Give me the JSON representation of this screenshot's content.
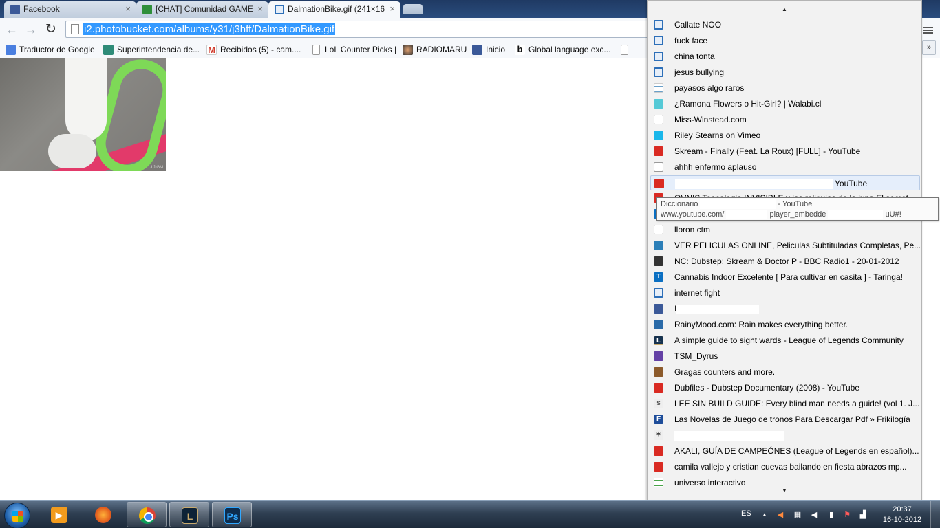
{
  "tabs": [
    {
      "title": "Facebook",
      "close": "×"
    },
    {
      "title": "[CHAT] Comunidad GAME",
      "close": "×"
    },
    {
      "title": "DalmationBike.gif (241×16",
      "close": "×"
    }
  ],
  "toolbar": {
    "back": "←",
    "forward": "→",
    "reload": "↻",
    "url": "i2.photobucket.com/albums/y31/j3hff/DalmationBike.gif"
  },
  "bookmarks": [
    {
      "label": "Traductor de Google",
      "icon": "translate-icon"
    },
    {
      "label": "Superintendencia de...",
      "icon": "si-icon"
    },
    {
      "label": "Recibidos (5) - cam....",
      "icon": "gmail-icon"
    },
    {
      "label": "LoL Counter Picks |",
      "icon": "page-icon"
    },
    {
      "label": "RADIOMARU",
      "icon": "avatar-icon"
    },
    {
      "label": "Inicio",
      "icon": "facebook-icon"
    },
    {
      "label": "Global language exc...",
      "icon": "b-icon"
    }
  ],
  "bookmarks_overflow": "»",
  "image": {
    "watermark": "J.J.GM"
  },
  "dropdown": {
    "scroll_up": "▲",
    "scroll_down": "▼",
    "items": [
      {
        "label": "Callate NOO",
        "icon": "photobucket-icon",
        "cls": "i-photo"
      },
      {
        "label": "fuck face",
        "icon": "photobucket-icon",
        "cls": "i-photo"
      },
      {
        "label": "china tonta",
        "icon": "photobucket-icon",
        "cls": "i-photo"
      },
      {
        "label": "jesus bullying",
        "icon": "photobucket-icon",
        "cls": "i-photo"
      },
      {
        "label": "payasos algo raros",
        "icon": "lines-icon",
        "cls": "i-lines"
      },
      {
        "label": "¿Ramona Flowers o Hit-Girl? | Walabi.cl",
        "icon": "walabi-icon",
        "cls": "i-walabi"
      },
      {
        "label": "Miss-Winstead.com",
        "icon": "page-icon",
        "cls": "i-doc"
      },
      {
        "label": "Riley Stearns on Vimeo",
        "icon": "vimeo-icon",
        "cls": "i-vimeo"
      },
      {
        "label": "Skream - Finally (Feat. La Roux) [FULL] - YouTube",
        "icon": "youtube-icon",
        "cls": "i-yt"
      },
      {
        "label": "ahhh enfermo aplauso",
        "icon": "page-icon",
        "cls": "i-doc"
      },
      {
        "label": "YouTube",
        "icon": "youtube-icon",
        "cls": "i-yt",
        "hover": true,
        "redact_before": 230
      },
      {
        "label": "OVNIS Tecnologia INVISIBLE y las reliquias de la luna El secret",
        "icon": "youtube-icon",
        "cls": "i-yt"
      },
      {
        "label": "",
        "icon": "blue-icon",
        "cls": "i-taringa"
      },
      {
        "label": "lloron ctm",
        "icon": "page-icon",
        "cls": "i-doc"
      },
      {
        "label": "VER PELICULAS ONLINE, Peliculas Subtituladas Completas, Pe...",
        "icon": "cine-icon",
        "cls": "i-cine"
      },
      {
        "label": "NC: Dubstep: Skream & Doctor P - BBC Radio1 - 20-01-2012",
        "icon": "dark-circle-icon",
        "cls": "i-dark"
      },
      {
        "label": "Cannabis Indoor Excelente [ Para cultivar en casita ] - Taringa!",
        "icon": "taringa-icon",
        "cls": "i-taringa",
        "glyph": "T"
      },
      {
        "label": "internet fight",
        "icon": "photobucket-icon",
        "cls": "i-photo"
      },
      {
        "label": "I",
        "icon": "facebook-icon",
        "cls": "i-fb",
        "redact_after": 120
      },
      {
        "label": "RainyMood.com: Rain makes everything better.",
        "icon": "raindrop-icon",
        "cls": "i-drop"
      },
      {
        "label": "A simple guide to sight wards - League of Legends Community",
        "icon": "lol-icon",
        "cls": "i-lol",
        "glyph": "L"
      },
      {
        "label": "TSM_Dyrus",
        "icon": "twitch-icon",
        "cls": "i-twitch"
      },
      {
        "label": "Gragas counters and more.",
        "icon": "gragas-icon",
        "cls": "i-gragas"
      },
      {
        "label": "Dubfiles - Dubstep Documentary (2008) - YouTube",
        "icon": "youtube-icon",
        "cls": "i-yt"
      },
      {
        "label": "LEE SIN BUILD GUIDE: Every blind man needs a guide! (vol 1. J...",
        "icon": "s-icon",
        "cls": "i-s",
        "glyph": "s"
      },
      {
        "label": "Las Novelas de Juego de tronos Para Descargar Pdf » Frikilogía",
        "icon": "frikilogia-icon",
        "cls": "i-frik",
        "glyph": "F"
      },
      {
        "label": "",
        "icon": "star-icon",
        "cls": "i-star",
        "glyph": "✶",
        "redact_after": 160
      },
      {
        "label": "AKALI, GUÍA DE CAMPEÓNES (League of Legends en español)...",
        "icon": "youtube-icon",
        "cls": "i-yt"
      },
      {
        "label": "camila vallejo y cristian cuevas bailando en fiesta abrazos mp...",
        "icon": "youtube-icon",
        "cls": "i-yt"
      },
      {
        "label": "universo interactivo",
        "icon": "lines-icon",
        "cls": "i-green"
      }
    ]
  },
  "tooltip": {
    "line1_start": "Diccionario",
    "line1_end": "- YouTube",
    "line2_start": "www.youtube.com/",
    "line2_mid": "player_embedde",
    "line2_end": "uU#!"
  },
  "taskbar": {
    "apps": [
      {
        "name": "media-player",
        "glyph": "▶"
      },
      {
        "name": "firefox",
        "glyph": ""
      },
      {
        "name": "chrome",
        "glyph": ""
      },
      {
        "name": "league-of-legends",
        "glyph": "L"
      },
      {
        "name": "photoshop",
        "glyph": "Ps"
      }
    ],
    "language": "ES",
    "show_hidden": "▲",
    "time": "20:37",
    "date": "16-10-2012"
  }
}
